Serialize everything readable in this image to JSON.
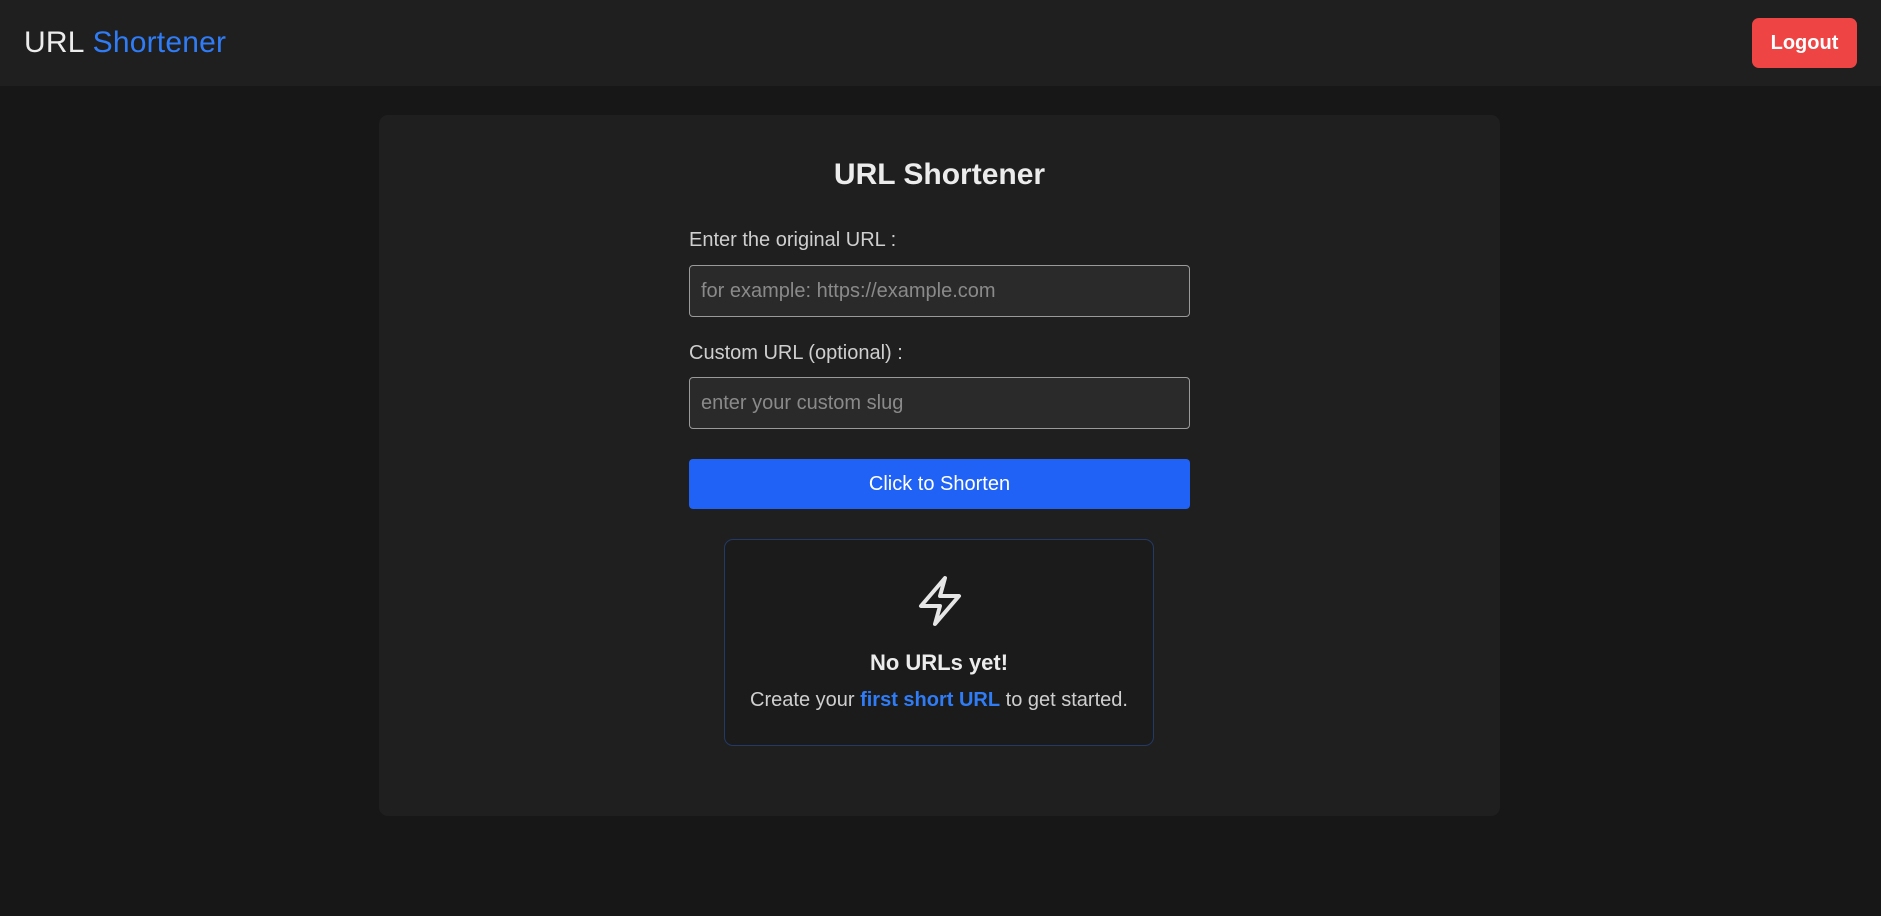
{
  "navbar": {
    "brand_part1": "URL",
    "brand_part2": "Shortener",
    "logout_label": "Logout"
  },
  "form": {
    "title": "URL Shortener",
    "original_url_label": "Enter the original URL :",
    "original_url_placeholder": "for example: https://example.com",
    "original_url_value": "",
    "custom_url_label": "Custom URL (optional) :",
    "custom_url_placeholder": "enter your custom slug",
    "custom_url_value": "",
    "submit_label": "Click to Shorten"
  },
  "empty_state": {
    "icon": "lightning-bolt-icon",
    "title": "No URLs yet!",
    "desc_prefix": "Create your",
    "desc_link": "first short URL",
    "desc_suffix": "to get started."
  },
  "colors": {
    "background": "#171717",
    "panel": "#1f1f1f",
    "accent": "#2f7cf6",
    "primary_button": "#2062f5",
    "danger_button": "#ef4444"
  }
}
